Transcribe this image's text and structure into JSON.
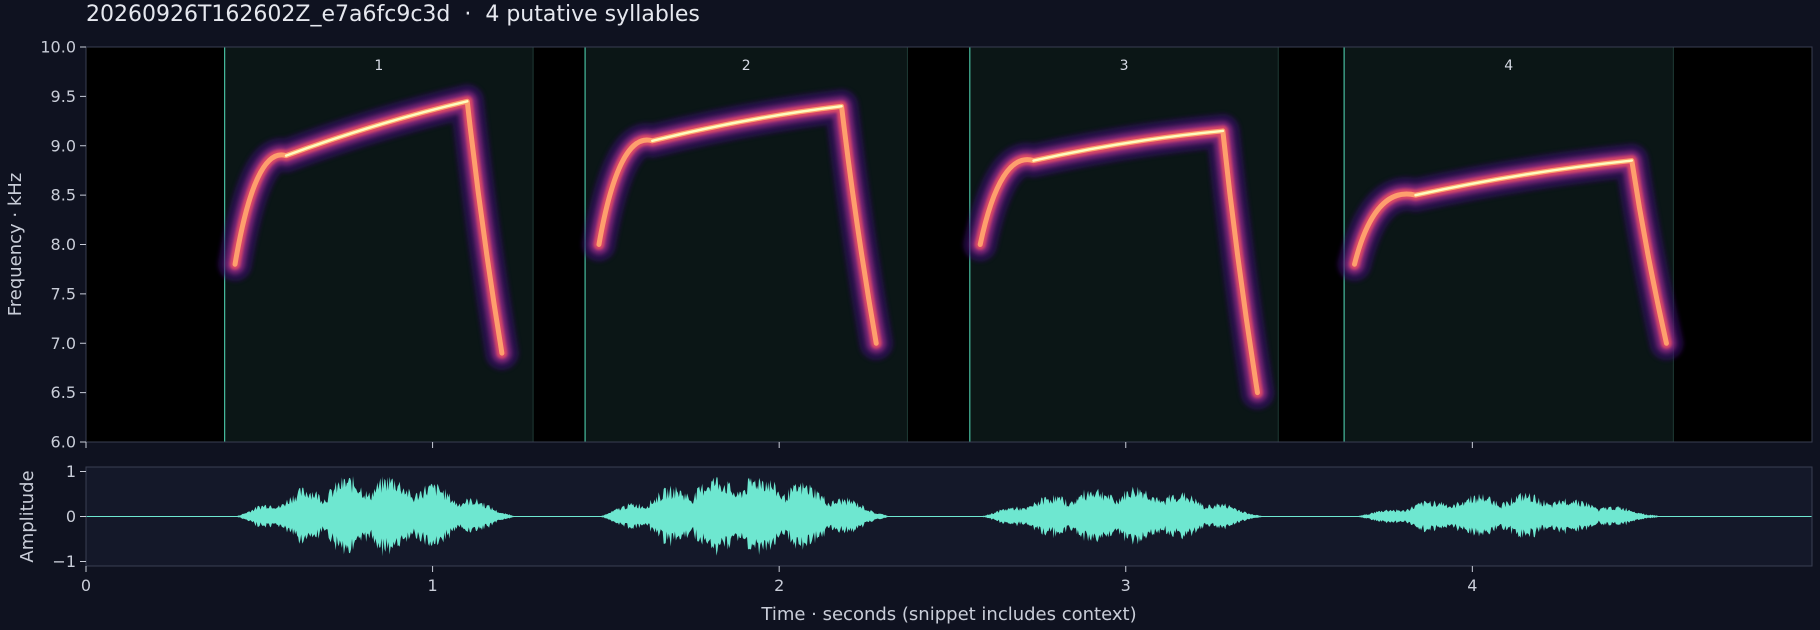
{
  "title": "20260926T162602Z_e7a6fc9c3d  ·  4 putative syllables",
  "chart_data": [
    {
      "type": "heatmap",
      "name": "spectrogram",
      "ylabel": "Frequency · kHz",
      "xlim": [
        0,
        4.98
      ],
      "ylim": [
        6.0,
        10.0
      ],
      "yticks": [
        "6.0",
        "6.5",
        "7.0",
        "7.5",
        "8.0",
        "8.5",
        "9.0",
        "9.5",
        "10.0"
      ],
      "colormap": [
        "#000004",
        "#3b0f70",
        "#8c2981",
        "#de4968",
        "#fe9f6d",
        "#fcfdbf"
      ],
      "segments": [
        {
          "label": "1",
          "start": 0.4,
          "end": 1.29
        },
        {
          "label": "2",
          "start": 1.44,
          "end": 2.37
        },
        {
          "label": "3",
          "start": 2.55,
          "end": 3.44
        },
        {
          "label": "4",
          "start": 3.63,
          "end": 4.58
        }
      ],
      "syllables": [
        {
          "label": "1",
          "start": 0.43,
          "end": 1.24,
          "sweep_end": 1.1,
          "f_start": 7.8,
          "f_knee": 8.9,
          "f_peak": 9.45,
          "f_tail": 6.9
        },
        {
          "label": "2",
          "start": 1.48,
          "end": 2.32,
          "sweep_end": 2.18,
          "f_start": 8.0,
          "f_knee": 9.05,
          "f_peak": 9.4,
          "f_tail": 7.0
        },
        {
          "label": "3",
          "start": 2.58,
          "end": 3.4,
          "sweep_end": 3.28,
          "f_start": 8.0,
          "f_knee": 8.85,
          "f_peak": 9.15,
          "f_tail": 6.5
        },
        {
          "label": "4",
          "start": 3.66,
          "end": 4.55,
          "sweep_end": 4.46,
          "f_start": 7.8,
          "f_knee": 8.5,
          "f_peak": 8.85,
          "f_tail": 7.0
        }
      ],
      "segment_edge_color": "#4fd1b0"
    },
    {
      "type": "area",
      "name": "waveform",
      "ylabel": "Amplitude",
      "xlabel": "Time · seconds (snippet includes context)",
      "xlim": [
        0,
        4.98
      ],
      "ylim": [
        -1.1,
        1.1
      ],
      "yticks": [
        "1",
        "0",
        "−1"
      ],
      "xticks": [
        "0",
        "1",
        "2",
        "3",
        "4"
      ],
      "color": "#6ee7d0",
      "envelope": [
        {
          "start": 0.43,
          "end": 1.24,
          "peak": 0.98
        },
        {
          "start": 1.48,
          "end": 2.32,
          "peak": 1.0
        },
        {
          "start": 2.58,
          "end": 3.4,
          "peak": 0.72
        },
        {
          "start": 3.66,
          "end": 4.55,
          "peak": 0.55
        }
      ]
    }
  ]
}
